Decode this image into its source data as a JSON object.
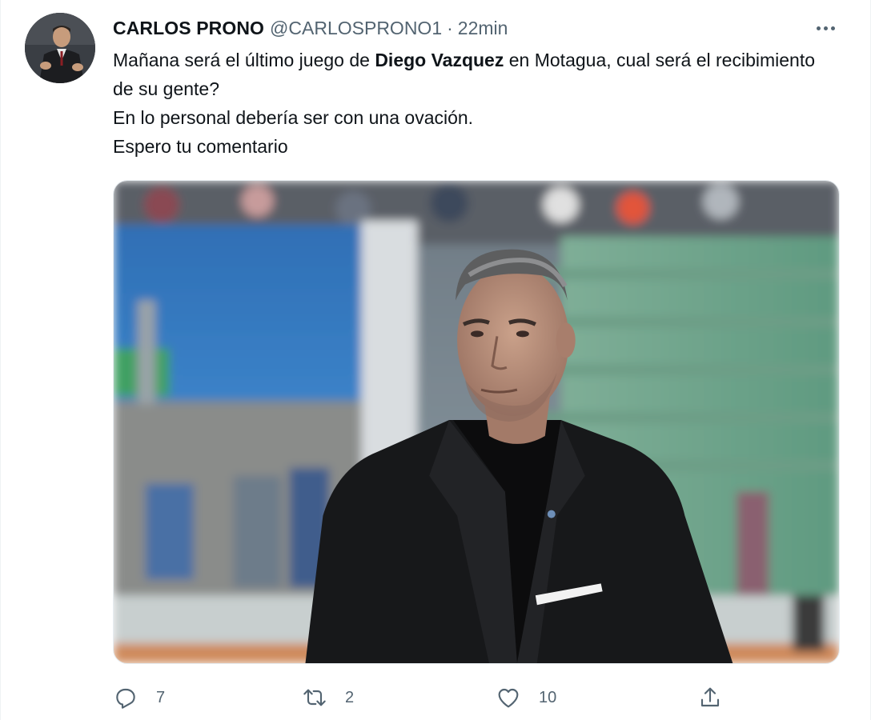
{
  "author": {
    "display_name": "CARLOS PRONO",
    "handle": "@CARLOSPRONO1",
    "separator": "·",
    "time": "22min"
  },
  "tweet": {
    "line1_before": "Mañana será el último juego de ",
    "line1_bold": "Diego Vazquez",
    "line1_after": " en Motagua, cual será el recibimiento de su gente?",
    "line2": "En lo personal debería ser con una ovación.",
    "line3": "Espero tu comentario"
  },
  "actions": {
    "reply_count": "7",
    "retweet_count": "2",
    "like_count": "10"
  },
  "icons": {
    "more": "more-horizontal-icon",
    "reply": "reply-icon",
    "retweet": "retweet-icon",
    "like": "heart-icon",
    "share": "share-icon"
  },
  "colors": {
    "text_primary": "#0f1419",
    "text_secondary": "#536471",
    "border": "#eff3f4"
  }
}
